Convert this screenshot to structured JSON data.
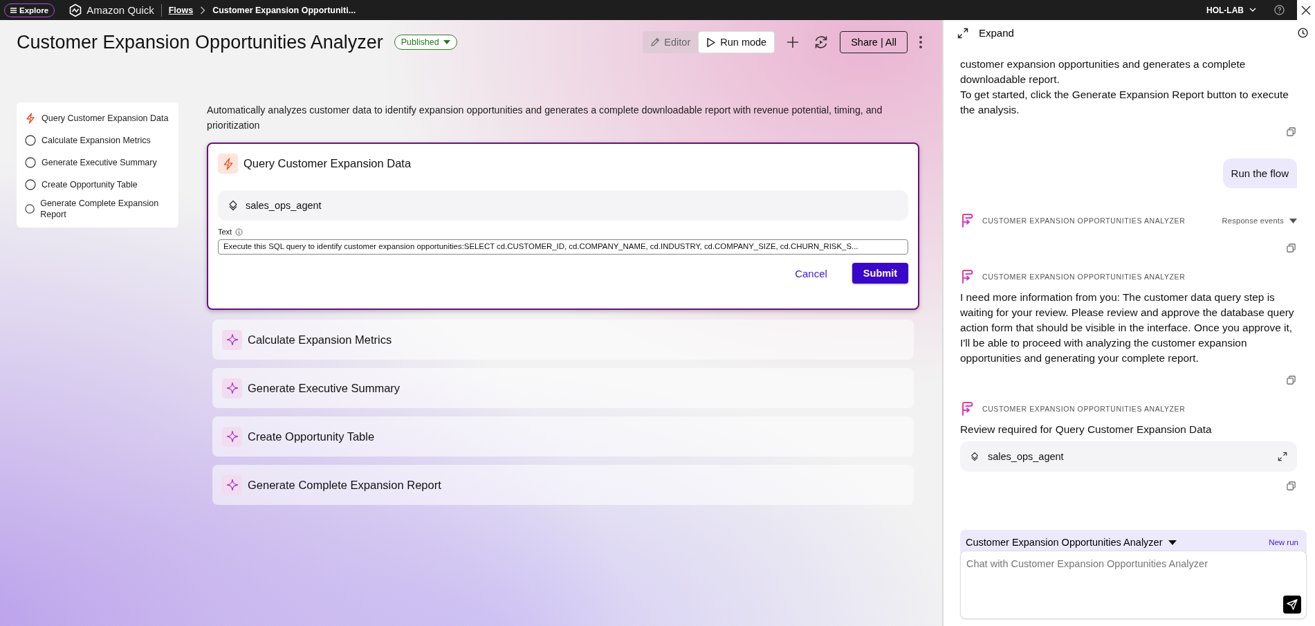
{
  "topbar": {
    "explore": "Explore",
    "brand": "Amazon Quick",
    "breadcrumb": [
      {
        "label": "Flows",
        "kind": "link"
      },
      {
        "label": "Customer Expansion Opportuniti...",
        "kind": "current"
      }
    ],
    "account": "HOL-LAB"
  },
  "header": {
    "title": "Customer Expansion Opportunities Analyzer",
    "status": "Published",
    "modes": [
      {
        "label": "Editor",
        "kind": "edit",
        "selected": false
      },
      {
        "label": "Run mode",
        "kind": "run",
        "selected": true
      }
    ],
    "share": "Share | All"
  },
  "description": "Automatically analyzes customer data to identify expansion opportunities and generates a complete downloadable report with revenue potential, timing, and prioritization",
  "steps": [
    {
      "label": "Query Customer Expansion Data",
      "current": true
    },
    {
      "label": "Calculate Expansion Metrics",
      "current": false
    },
    {
      "label": "Generate Executive Summary",
      "current": false
    },
    {
      "label": "Create Opportunity Table",
      "current": false
    },
    {
      "label": "Generate Complete Expansion Report",
      "current": false
    }
  ],
  "cards": [
    {
      "title": "Query Customer Expansion Data",
      "kind": "action",
      "expanded": true,
      "agent": "sales_ops_agent",
      "field_label": "Text",
      "field_value": "Execute this SQL query to identify customer expansion opportunities:SELECT   cd.CUSTOMER_ID,  cd.COMPANY_NAME,  cd.INDUSTRY,  cd.COMPANY_SIZE,  cd.CHURN_RISK_S...",
      "cancel": "Cancel",
      "submit": "Submit"
    },
    {
      "title": "Calculate Expansion Metrics",
      "kind": "ai",
      "expanded": false
    },
    {
      "title": "Generate Executive Summary",
      "kind": "ai",
      "expanded": false
    },
    {
      "title": "Create Opportunity Table",
      "kind": "ai",
      "expanded": false
    },
    {
      "title": "Generate Complete Expansion Report",
      "kind": "ai",
      "expanded": false
    }
  ],
  "chat": {
    "expand": "Expand",
    "messages": [
      {
        "kind": "text",
        "paragraphs": [
          "customer expansion opportunities and generates a complete downloadable report.",
          "To get started, click the Generate Expansion Report button to execute the analysis."
        ]
      },
      {
        "kind": "user",
        "text": "Run the flow"
      },
      {
        "kind": "bot",
        "sender": "CUSTOMER EXPANSION OPPORTUNITIES ANALYZER",
        "events": "Response events"
      },
      {
        "kind": "bot",
        "sender": "CUSTOMER EXPANSION OPPORTUNITIES ANALYZER",
        "body": "I need more information from you: The customer data query step is waiting for your review. Please review and approve the database query action form that should be visible in the interface. Once you approve it, I'll be able to proceed with analyzing the customer expansion opportunities and generating your complete report."
      },
      {
        "kind": "bot",
        "sender": "CUSTOMER EXPANSION OPPORTUNITIES ANALYZER",
        "body": "Review required for Query Customer Expansion Data",
        "agent": "sales_ops_agent"
      }
    ],
    "composer": {
      "flow": "Customer Expansion Opportunities Analyzer",
      "new_run": "New run",
      "placeholder": "Chat with Customer Expansion Opportunities Analyzer"
    }
  }
}
